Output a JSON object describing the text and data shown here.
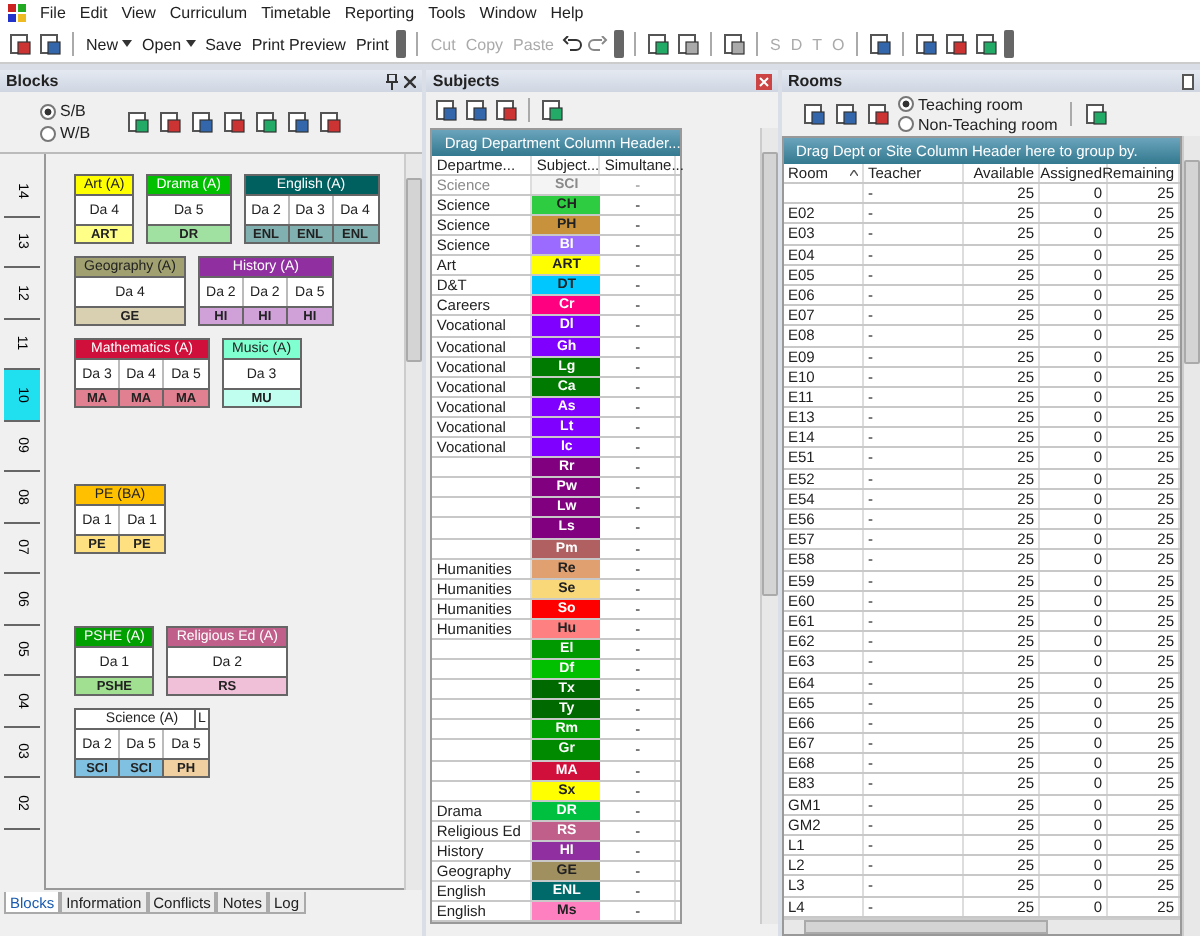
{
  "menu": [
    "File",
    "Edit",
    "View",
    "Curriculum",
    "Timetable",
    "Reporting",
    "Tools",
    "Window",
    "Help"
  ],
  "toolbar": {
    "file_buttons": [
      {
        "label": "New",
        "dropdown": true,
        "disabled": false
      },
      {
        "label": "Open",
        "dropdown": true,
        "disabled": false
      },
      {
        "label": "Save",
        "dropdown": false,
        "disabled": false
      },
      {
        "label": "Print Preview",
        "dropdown": false,
        "disabled": false
      },
      {
        "label": "Print",
        "dropdown": false,
        "disabled": false
      }
    ],
    "edit_buttons": [
      {
        "label": "Cut",
        "disabled": true
      },
      {
        "label": "Copy",
        "disabled": true
      },
      {
        "label": "Paste",
        "disabled": true
      }
    ],
    "view_buttons": [
      {
        "label": "S",
        "disabled": true
      },
      {
        "label": "D",
        "disabled": true
      },
      {
        "label": "T",
        "disabled": true
      },
      {
        "label": "O",
        "disabled": true
      }
    ]
  },
  "blocks": {
    "title": "Blocks",
    "modes": [
      {
        "label": "S/B",
        "selected": true
      },
      {
        "label": "W/B",
        "selected": false
      }
    ],
    "year_tabs": [
      {
        "label": "14",
        "selected": false
      },
      {
        "label": "13",
        "selected": false
      },
      {
        "label": "12",
        "selected": false
      },
      {
        "label": "11",
        "selected": false
      },
      {
        "label": "10",
        "selected": true
      },
      {
        "label": "09",
        "selected": false
      },
      {
        "label": "08",
        "selected": false
      },
      {
        "label": "07",
        "selected": false
      },
      {
        "label": "06",
        "selected": false
      },
      {
        "label": "05",
        "selected": false
      },
      {
        "label": "04",
        "selected": false
      },
      {
        "label": "03",
        "selected": false
      },
      {
        "label": "02",
        "selected": false
      }
    ],
    "rows": [
      [
        {
          "name": "Art (A)",
          "color": "#ffff00",
          "periods": [
            "Da 4"
          ],
          "codes": [
            {
              "code": "ART",
              "color": "#ffff88"
            }
          ]
        },
        {
          "name": "Drama (A)",
          "color": "#00c000",
          "periods": [
            "Da 5"
          ],
          "codes": [
            {
              "code": "DR",
              "color": "#a0e0a0"
            }
          ]
        },
        {
          "name": "English (A)",
          "color": "#006060",
          "periods": [
            "Da 2",
            "Da 3",
            "Da 4"
          ],
          "codes": [
            {
              "code": "ENL",
              "color": "#80b0b0"
            },
            {
              "code": "ENL",
              "color": "#80b0b0"
            },
            {
              "code": "ENL",
              "color": "#80b0b0"
            }
          ]
        }
      ],
      [
        {
          "name": "Geography (A)",
          "color": "#a0a070",
          "periods": [
            "Da 4"
          ],
          "codes": [
            {
              "code": "GE",
              "color": "#d8d0b0"
            }
          ]
        },
        {
          "name": "History (A)",
          "color": "#9030a0",
          "periods": [
            "Da 2",
            "Da 2",
            "Da 5"
          ],
          "codes": [
            {
              "code": "HI",
              "color": "#d0a0d8"
            },
            {
              "code": "HI",
              "color": "#d0a0d8"
            },
            {
              "code": "HI",
              "color": "#d0a0d8"
            }
          ]
        }
      ],
      [
        {
          "name": "Mathematics (A)",
          "color": "#d0103a",
          "periods": [
            "Da 3",
            "Da 4",
            "Da 5"
          ],
          "codes": [
            {
              "code": "MA",
              "color": "#e08090"
            },
            {
              "code": "MA",
              "color": "#e08090"
            },
            {
              "code": "MA",
              "color": "#e08090"
            }
          ]
        },
        {
          "name": "Music (A)",
          "color": "#80ffd0",
          "periods": [
            "Da 3"
          ],
          "codes": [
            {
              "code": "MU",
              "color": "#c0fff0"
            }
          ]
        }
      ],
      [
        {
          "name": "PE (BA)",
          "color": "#ffc000",
          "periods": [
            "Da 1",
            "Da 1"
          ],
          "codes": [
            {
              "code": "PE",
              "color": "#ffe080"
            },
            {
              "code": "PE",
              "color": "#ffe080"
            }
          ]
        }
      ],
      [
        {
          "name": "PSHE (A)",
          "color": "#00a000",
          "periods": [
            "Da 1"
          ],
          "codes": [
            {
              "code": "PSHE",
              "color": "#a0e090"
            }
          ]
        },
        {
          "name": "Religious Ed (A)",
          "color": "#c0608a",
          "periods": [
            "Da 2"
          ],
          "codes": [
            {
              "code": "RS",
              "color": "#f0c0d8"
            }
          ]
        }
      ],
      [
        {
          "name": "Science (A)",
          "flag": "L",
          "color": "#ffffff",
          "periods": [
            "Da 2",
            "Da 5",
            "Da 5"
          ],
          "codes": [
            {
              "code": "SCI",
              "color": "#80c0e0"
            },
            {
              "code": "SCI",
              "color": "#80c0e0"
            },
            {
              "code": "PH",
              "color": "#f0d0a0"
            }
          ]
        }
      ]
    ],
    "bottom_tabs": [
      {
        "label": "Blocks",
        "selected": true
      },
      {
        "label": "Information",
        "selected": false
      },
      {
        "label": "Conflicts",
        "selected": false
      },
      {
        "label": "Notes",
        "selected": false
      },
      {
        "label": "Log",
        "selected": false
      }
    ]
  },
  "subjects": {
    "title": "Subjects",
    "group_hint": "Drag Department Column Header...",
    "columns": [
      "Departme...",
      "Subject...",
      "Simultane..."
    ],
    "rows": [
      {
        "department": "Science",
        "subject": "SCI",
        "color": "#f4f4f4",
        "simultaneous": "-",
        "dimmed": true
      },
      {
        "department": "Science",
        "subject": "CH",
        "color": "#2ecc40",
        "simultaneous": "-",
        "dimmed": false
      },
      {
        "department": "Science",
        "subject": "PH",
        "color": "#c8923c",
        "simultaneous": "-",
        "dimmed": false
      },
      {
        "department": "Science",
        "subject": "BI",
        "color": "#9b6bff",
        "simultaneous": "-",
        "dimmed": false
      },
      {
        "department": "Art",
        "subject": "ART",
        "color": "#ffff00",
        "simultaneous": "-",
        "dimmed": false
      },
      {
        "department": "D&T",
        "subject": "DT",
        "color": "#00c8ff",
        "simultaneous": "-",
        "dimmed": false
      },
      {
        "department": "Careers",
        "subject": "Cr",
        "color": "#ff0080",
        "simultaneous": "-",
        "dimmed": false
      },
      {
        "department": "Vocational",
        "subject": "Dl",
        "color": "#8000ff",
        "simultaneous": "-",
        "dimmed": false
      },
      {
        "department": "Vocational",
        "subject": "Gh",
        "color": "#8000ff",
        "simultaneous": "-",
        "dimmed": false
      },
      {
        "department": "Vocational",
        "subject": "Lg",
        "color": "#007a00",
        "simultaneous": "-",
        "dimmed": false
      },
      {
        "department": "Vocational",
        "subject": "Ca",
        "color": "#007a00",
        "simultaneous": "-",
        "dimmed": false
      },
      {
        "department": "Vocational",
        "subject": "As",
        "color": "#8000ff",
        "simultaneous": "-",
        "dimmed": false
      },
      {
        "department": "Vocational",
        "subject": "Lt",
        "color": "#8000ff",
        "simultaneous": "-",
        "dimmed": false
      },
      {
        "department": "Vocational",
        "subject": "Ic",
        "color": "#8000ff",
        "simultaneous": "-",
        "dimmed": false
      },
      {
        "subject": "Rr",
        "color": "#800080",
        "simultaneous": "-",
        "dimmed": false
      },
      {
        "subject": "Pw",
        "color": "#800080",
        "simultaneous": "-",
        "dimmed": false
      },
      {
        "subject": "Lw",
        "color": "#800080",
        "simultaneous": "-",
        "dimmed": false
      },
      {
        "subject": "Ls",
        "color": "#800080",
        "simultaneous": "-",
        "dimmed": false
      },
      {
        "subject": "Pm",
        "color": "#b06060",
        "simultaneous": "-",
        "dimmed": false
      },
      {
        "department": "Humanities",
        "subject": "Re",
        "color": "#e0a070",
        "simultaneous": "-",
        "dimmed": false
      },
      {
        "department": "Humanities",
        "subject": "Se",
        "color": "#f8d878",
        "simultaneous": "-",
        "dimmed": false
      },
      {
        "department": "Humanities",
        "subject": "So",
        "color": "#ff0000",
        "simultaneous": "-",
        "dimmed": false
      },
      {
        "department": "Humanities",
        "subject": "Hu",
        "color": "#ff8080",
        "simultaneous": "-",
        "dimmed": false
      },
      {
        "subject": "El",
        "color": "#009a00",
        "simultaneous": "-",
        "dimmed": false
      },
      {
        "subject": "Df",
        "color": "#00c000",
        "simultaneous": "-",
        "dimmed": false
      },
      {
        "subject": "Tx",
        "color": "#006a00",
        "simultaneous": "-",
        "dimmed": false
      },
      {
        "subject": "Ty",
        "color": "#006a00",
        "simultaneous": "-",
        "dimmed": false
      },
      {
        "subject": "Rm",
        "color": "#00a000",
        "simultaneous": "-",
        "dimmed": false
      },
      {
        "subject": "Gr",
        "color": "#008a00",
        "simultaneous": "-",
        "dimmed": false
      },
      {
        "subject": "MA",
        "color": "#d0103a",
        "simultaneous": "-",
        "dimmed": false
      },
      {
        "subject": "Sx",
        "color": "#ffff00",
        "simultaneous": "-",
        "dimmed": false
      },
      {
        "department": "Drama",
        "subject": "DR",
        "color": "#00c040",
        "simultaneous": "-",
        "dimmed": false
      },
      {
        "department": "Religious Ed",
        "subject": "RS",
        "color": "#c0608a",
        "simultaneous": "-",
        "dimmed": false
      },
      {
        "department": "History",
        "subject": "HI",
        "color": "#9030a0",
        "simultaneous": "-",
        "dimmed": false
      },
      {
        "department": "Geography",
        "subject": "GE",
        "color": "#a09060",
        "simultaneous": "-",
        "dimmed": false
      },
      {
        "department": "English",
        "subject": "ENL",
        "color": "#006a6a",
        "simultaneous": "-",
        "dimmed": false
      },
      {
        "department": "English",
        "subject": "Ms",
        "color": "#ff80c0",
        "simultaneous": "-",
        "dimmed": false
      }
    ]
  },
  "rooms": {
    "title": "Rooms",
    "types": [
      {
        "label": "Teaching room",
        "selected": true
      },
      {
        "label": "Non-Teaching room",
        "selected": false
      }
    ],
    "group_hint": "Drag Dept or Site Column Header here to group by.",
    "columns": [
      "Room",
      "Teacher",
      "Available",
      "Assigned",
      "Remaining"
    ],
    "rows": [
      {
        "teacher": "-",
        "available": "25",
        "assigned": "0",
        "remaining": "25"
      },
      {
        "room": "E02",
        "teacher": "-",
        "available": "25",
        "assigned": "0",
        "remaining": "25"
      },
      {
        "room": "E03",
        "teacher": "-",
        "available": "25",
        "assigned": "0",
        "remaining": "25"
      },
      {
        "room": "E04",
        "teacher": "-",
        "available": "25",
        "assigned": "0",
        "remaining": "25"
      },
      {
        "room": "E05",
        "teacher": "-",
        "available": "25",
        "assigned": "0",
        "remaining": "25"
      },
      {
        "room": "E06",
        "teacher": "-",
        "available": "25",
        "assigned": "0",
        "remaining": "25"
      },
      {
        "room": "E07",
        "teacher": "-",
        "available": "25",
        "assigned": "0",
        "remaining": "25"
      },
      {
        "room": "E08",
        "teacher": "-",
        "available": "25",
        "assigned": "0",
        "remaining": "25"
      },
      {
        "room": "E09",
        "teacher": "-",
        "available": "25",
        "assigned": "0",
        "remaining": "25"
      },
      {
        "room": "E10",
        "teacher": "-",
        "available": "25",
        "assigned": "0",
        "remaining": "25"
      },
      {
        "room": "E11",
        "teacher": "-",
        "available": "25",
        "assigned": "0",
        "remaining": "25"
      },
      {
        "room": "E13",
        "teacher": "-",
        "available": "25",
        "assigned": "0",
        "remaining": "25"
      },
      {
        "room": "E14",
        "teacher": "-",
        "available": "25",
        "assigned": "0",
        "remaining": "25"
      },
      {
        "room": "E51",
        "teacher": "-",
        "available": "25",
        "assigned": "0",
        "remaining": "25"
      },
      {
        "room": "E52",
        "teacher": "-",
        "available": "25",
        "assigned": "0",
        "remaining": "25"
      },
      {
        "room": "E54",
        "teacher": "-",
        "available": "25",
        "assigned": "0",
        "remaining": "25"
      },
      {
        "room": "E56",
        "teacher": "-",
        "available": "25",
        "assigned": "0",
        "remaining": "25"
      },
      {
        "room": "E57",
        "teacher": "-",
        "available": "25",
        "assigned": "0",
        "remaining": "25"
      },
      {
        "room": "E58",
        "teacher": "-",
        "available": "25",
        "assigned": "0",
        "remaining": "25"
      },
      {
        "room": "E59",
        "teacher": "-",
        "available": "25",
        "assigned": "0",
        "remaining": "25"
      },
      {
        "room": "E60",
        "teacher": "-",
        "available": "25",
        "assigned": "0",
        "remaining": "25"
      },
      {
        "room": "E61",
        "teacher": "-",
        "available": "25",
        "assigned": "0",
        "remaining": "25"
      },
      {
        "room": "E62",
        "teacher": "-",
        "available": "25",
        "assigned": "0",
        "remaining": "25"
      },
      {
        "room": "E63",
        "teacher": "-",
        "available": "25",
        "assigned": "0",
        "remaining": "25"
      },
      {
        "room": "E64",
        "teacher": "-",
        "available": "25",
        "assigned": "0",
        "remaining": "25"
      },
      {
        "room": "E65",
        "teacher": "-",
        "available": "25",
        "assigned": "0",
        "remaining": "25"
      },
      {
        "room": "E66",
        "teacher": "-",
        "available": "25",
        "assigned": "0",
        "remaining": "25"
      },
      {
        "room": "E67",
        "teacher": "-",
        "available": "25",
        "assigned": "0",
        "remaining": "25"
      },
      {
        "room": "E68",
        "teacher": "-",
        "available": "25",
        "assigned": "0",
        "remaining": "25"
      },
      {
        "room": "E83",
        "teacher": "-",
        "available": "25",
        "assigned": "0",
        "remaining": "25"
      },
      {
        "room": "GM1",
        "teacher": "-",
        "available": "25",
        "assigned": "0",
        "remaining": "25"
      },
      {
        "room": "GM2",
        "teacher": "-",
        "available": "25",
        "assigned": "0",
        "remaining": "25"
      },
      {
        "room": "L1",
        "teacher": "-",
        "available": "25",
        "assigned": "0",
        "remaining": "25"
      },
      {
        "room": "L2",
        "teacher": "-",
        "available": "25",
        "assigned": "0",
        "remaining": "25"
      },
      {
        "room": "L3",
        "teacher": "-",
        "available": "25",
        "assigned": "0",
        "remaining": "25"
      },
      {
        "room": "L4",
        "teacher": "-",
        "available": "25",
        "assigned": "0",
        "remaining": "25"
      }
    ]
  }
}
